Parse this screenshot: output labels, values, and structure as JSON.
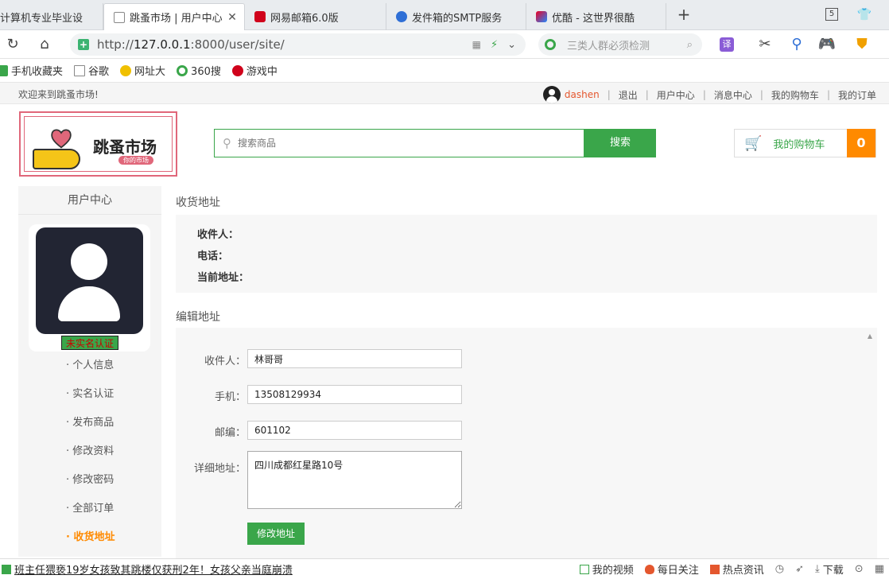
{
  "browser": {
    "tabs": [
      {
        "title": "计算机专业毕业设"
      },
      {
        "title": "跳蚤市场 | 用户中心"
      },
      {
        "title": "网易邮箱6.0版"
      },
      {
        "title": "发件箱的SMTP服务"
      },
      {
        "title": "优酷 - 这世界很酷"
      }
    ],
    "new_tab_label": "+",
    "tab_count": "5",
    "url_prefix": "http://",
    "url_host": "127.0.0.1",
    "url_path": ":8000/user/site/",
    "search_placeholder": "三类人群必须检测",
    "bookmarks": [
      "手机收藏夹",
      "谷歌",
      "网址大",
      "360搜",
      "游戏中"
    ]
  },
  "site": {
    "welcome": "欢迎来到跳蚤市场!",
    "username": "dashen",
    "nav": [
      "退出",
      "用户中心",
      "消息中心",
      "我的购物车",
      "我的订单"
    ],
    "logo_title": "跳蚤市场",
    "logo_pill": "你的市场",
    "search_placeholder": "搜索商品",
    "search_button": "搜索",
    "cart_label": "我的购物车",
    "cart_count": "0"
  },
  "sidebar": {
    "title": "用户中心",
    "badge": "未实名认证",
    "items": [
      "· 个人信息",
      "· 实名认证",
      "· 发布商品",
      "· 修改资料",
      "· 修改密码",
      "· 全部订单",
      "· 收货地址"
    ]
  },
  "address": {
    "section_title": "收货地址",
    "receiver_label": "收件人：",
    "phone_label": "电话：",
    "current_label": "当前地址："
  },
  "edit": {
    "section_title": "编辑地址",
    "receiver_label": "收件人：",
    "receiver_value": "林哥哥",
    "mobile_label": "手机：",
    "mobile_value": "13508129934",
    "zip_label": "邮编：",
    "zip_value": "601102",
    "detail_label": "详细地址：",
    "detail_value": "四川成都红星路10号",
    "submit": "修改地址"
  },
  "statusbar": {
    "news": "班主任猥亵19岁女孩致其跳楼仅获刑2年！女孩父亲当庭崩溃",
    "items": [
      "我的视频",
      "每日关注",
      "热点资讯",
      "下载"
    ]
  }
}
